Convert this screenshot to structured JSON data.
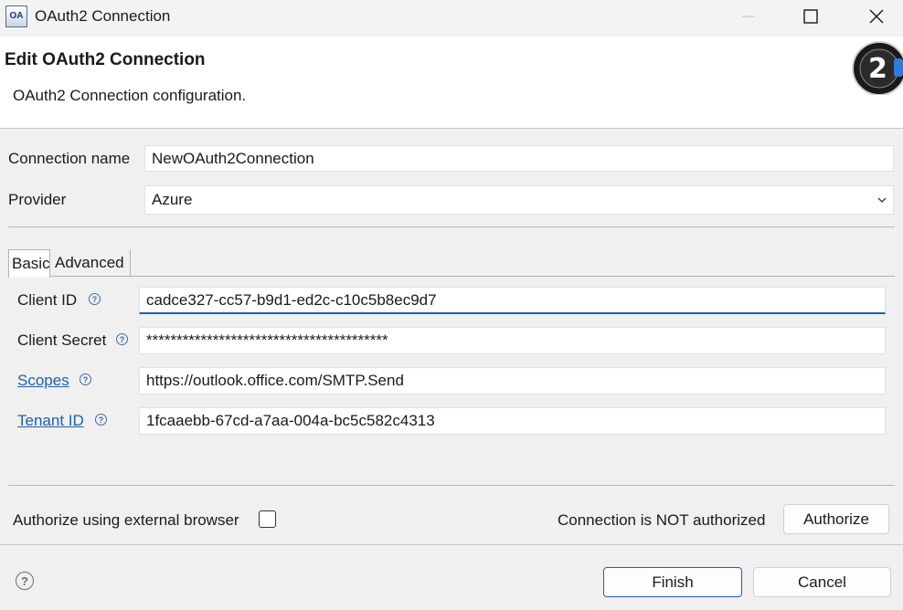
{
  "window": {
    "title": "OAuth2 Connection",
    "app_icon_text": "OA"
  },
  "header": {
    "title": "Edit OAuth2 Connection",
    "description": "OAuth2 Connection configuration.",
    "logo_text": "2"
  },
  "form": {
    "connection_name": {
      "label": "Connection name",
      "value": "NewOAuth2Connection"
    },
    "provider": {
      "label": "Provider",
      "value": "Azure"
    }
  },
  "tabs": [
    {
      "label": "Basic",
      "selected": true
    },
    {
      "label": "Advanced",
      "selected": false
    }
  ],
  "basic": {
    "client_id": {
      "label": "Client ID",
      "value": "cadce327-cc57-b9d1-ed2c-c10c5b8ec9d7"
    },
    "client_secret": {
      "label": "Client Secret",
      "value": "****************************************"
    },
    "scopes": {
      "label": "Scopes",
      "value": "https://outlook.office.com/SMTP.Send"
    },
    "tenant_id": {
      "label": "Tenant ID",
      "value": "1fcaaebb-67cd-a7aa-004a-bc5c582c4313"
    }
  },
  "authorize": {
    "external_browser_label": "Authorize using external browser",
    "external_browser_checked": false,
    "status": "Connection is NOT authorized",
    "button_label": "Authorize"
  },
  "footer": {
    "help_symbol": "?",
    "finish_label": "Finish",
    "cancel_label": "Cancel"
  },
  "colors": {
    "accent": "#1f5fa8",
    "link": "#1f5fa8"
  },
  "icons": {
    "help": "question-circle-icon",
    "combo": "chevron-down-icon",
    "minimize": "minimize-icon",
    "maximize": "maximize-icon",
    "close": "close-icon"
  }
}
